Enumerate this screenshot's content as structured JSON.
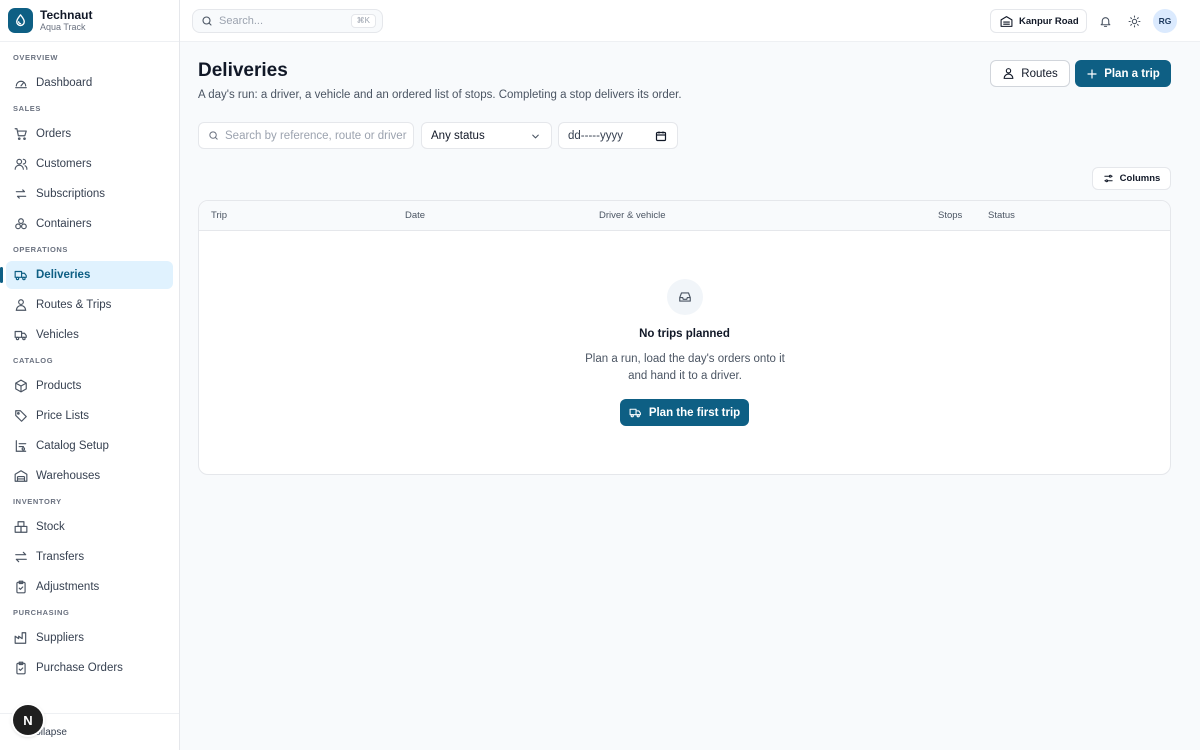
{
  "brand": {
    "name": "Technaut",
    "subtitle": "Aqua Track"
  },
  "search": {
    "placeholder": "Search...",
    "shortcut": "⌘K"
  },
  "topbar": {
    "location": "Kanpur Road",
    "avatar_initials": "RG"
  },
  "sidebar": {
    "sections": {
      "overview": "OVERVIEW",
      "sales": "SALES",
      "operations": "OPERATIONS",
      "catalog": "CATALOG",
      "inventory": "INVENTORY",
      "purchasing": "PURCHASING"
    },
    "items": {
      "dashboard": "Dashboard",
      "orders": "Orders",
      "customers": "Customers",
      "subscriptions": "Subscriptions",
      "containers": "Containers",
      "deliveries": "Deliveries",
      "routes_trips": "Routes & Trips",
      "vehicles": "Vehicles",
      "products": "Products",
      "price_lists": "Price Lists",
      "catalog_setup": "Catalog Setup",
      "warehouses": "Warehouses",
      "stock": "Stock",
      "transfers": "Transfers",
      "adjustments": "Adjustments",
      "suppliers": "Suppliers",
      "purchase_orders": "Purchase Orders"
    },
    "active": "deliveries",
    "collapse_label": "Collapse",
    "floating_badge": "N"
  },
  "page": {
    "title": "Deliveries",
    "subtitle": "A day's run: a driver, a vehicle and an ordered list of stops. Completing a stop delivers its order.",
    "routes_button": "Routes",
    "plan_button": "Plan a trip"
  },
  "filters": {
    "search_placeholder": "Search by reference, route or driver",
    "status_value": "Any status",
    "date_value": "dd-----yyyy"
  },
  "table": {
    "columns_button": "Columns",
    "headers": [
      "Trip",
      "Date",
      "Driver & vehicle",
      "Stops",
      "Status"
    ]
  },
  "empty": {
    "title": "No trips planned",
    "description": "Plan a run, load the day's orders onto it and hand it to a driver.",
    "button": "Plan the first trip"
  },
  "colors": {
    "accent": "#0e5f84",
    "active_bg": "#e0f2fe"
  }
}
